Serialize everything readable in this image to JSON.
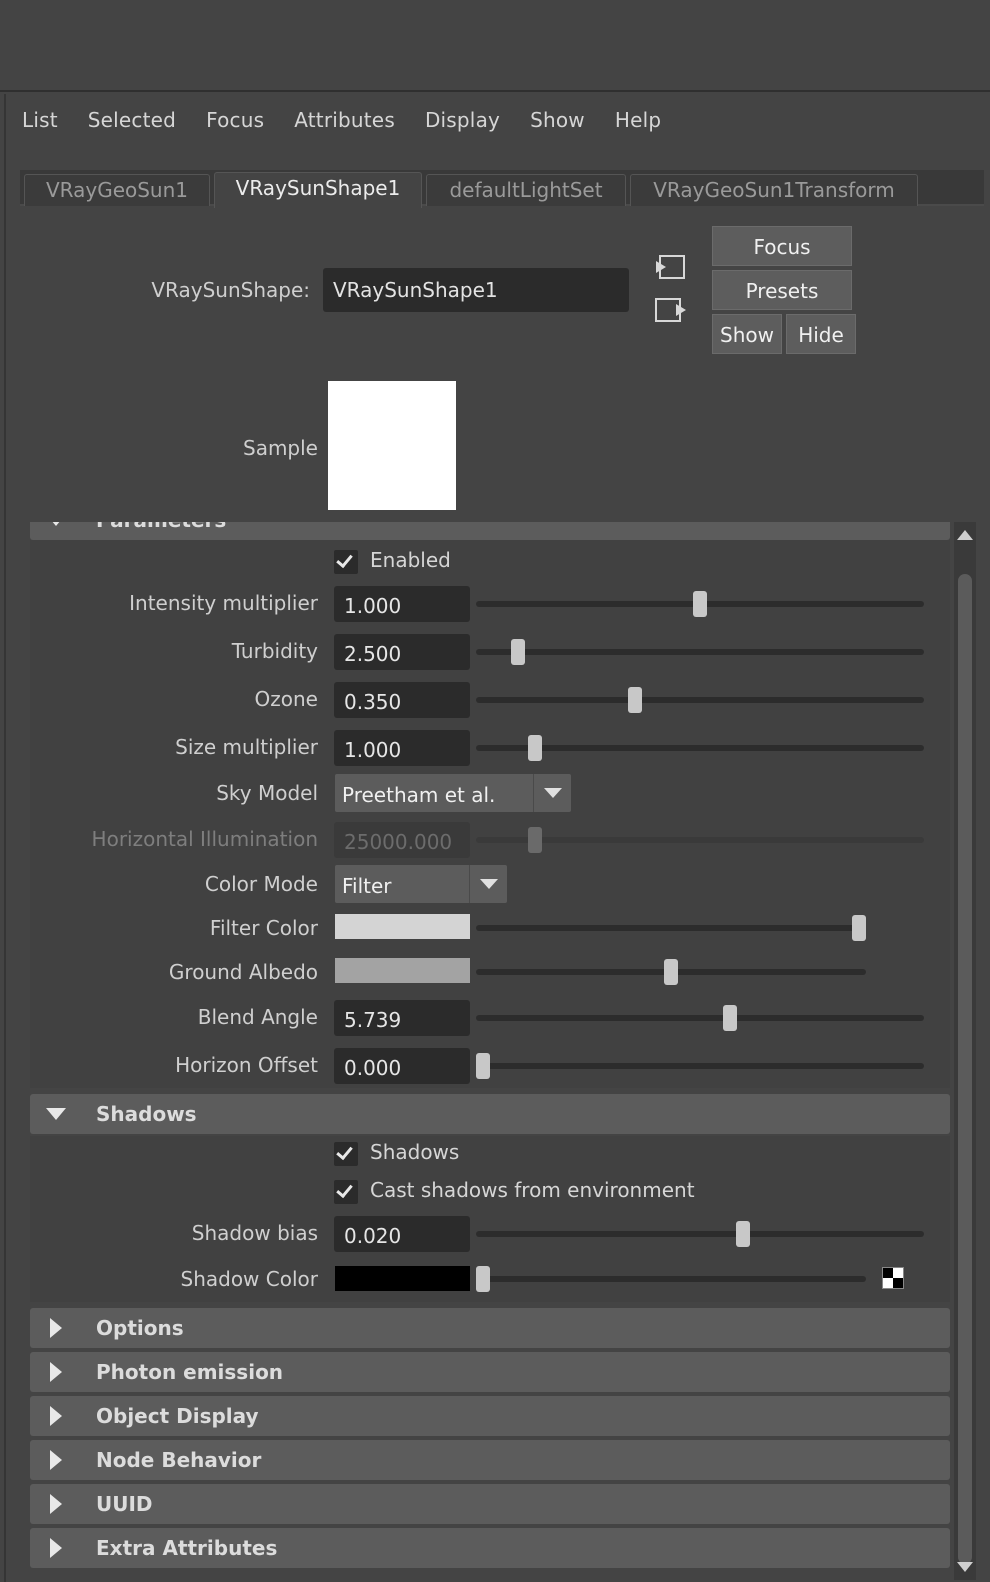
{
  "menubar": [
    "List",
    "Selected",
    "Focus",
    "Attributes",
    "Display",
    "Show",
    "Help"
  ],
  "tabs": [
    "VRayGeoSun1",
    "VRaySunShape1",
    "defaultLightSet",
    "VRayGeoSun1Transform"
  ],
  "active_tab": "VRaySunShape1",
  "header": {
    "node_type_label": "VRaySunShape:",
    "node_name": "VRaySunShape1",
    "focus_label": "Focus",
    "presets_label": "Presets",
    "show_label": "Show",
    "hide_label": "Hide",
    "sample_label": "Sample",
    "sample_color": "#ffffff"
  },
  "parameters": {
    "title": "Parameters",
    "enabled_label": "Enabled",
    "enabled": true,
    "intensity_label": "Intensity multiplier",
    "intensity_value": "1.000",
    "intensity_slider": 0.5,
    "turbidity_label": "Turbidity",
    "turbidity_value": "2.500",
    "turbidity_slider": 0.08,
    "ozone_label": "Ozone",
    "ozone_value": "0.350",
    "ozone_slider": 0.35,
    "size_label": "Size multiplier",
    "size_value": "1.000",
    "size_slider": 0.12,
    "sky_model_label": "Sky Model",
    "sky_model_value": "Preetham et al.",
    "horizontal_illum_label": "Horizontal Illumination",
    "horizontal_illum_value": "25000.000",
    "horizontal_illum_slider": 0.12,
    "color_mode_label": "Color Mode",
    "color_mode_value": "Filter",
    "filter_color_label": "Filter Color",
    "filter_color": "#d4d4d4",
    "filter_color_slider": 1.0,
    "ground_albedo_label": "Ground Albedo",
    "ground_albedo_color": "#a3a3a3",
    "ground_albedo_slider": 0.5,
    "blend_angle_label": "Blend Angle",
    "blend_angle_value": "5.739",
    "blend_angle_slider": 0.57,
    "horizon_offset_label": "Horizon Offset",
    "horizon_offset_value": "0.000",
    "horizon_offset_slider": 0.0
  },
  "shadows": {
    "title": "Shadows",
    "shadows_label": "Shadows",
    "shadows_enabled": true,
    "cast_env_label": "Cast shadows from environment",
    "cast_env_enabled": true,
    "bias_label": "Shadow bias",
    "bias_value": "0.020",
    "bias_slider": 0.6,
    "color_label": "Shadow Color",
    "color": "#000000",
    "color_slider": 0.0
  },
  "collapsed_sections": [
    "Options",
    "Photon emission",
    "Object Display",
    "Node Behavior",
    "UUID",
    "Extra Attributes"
  ]
}
